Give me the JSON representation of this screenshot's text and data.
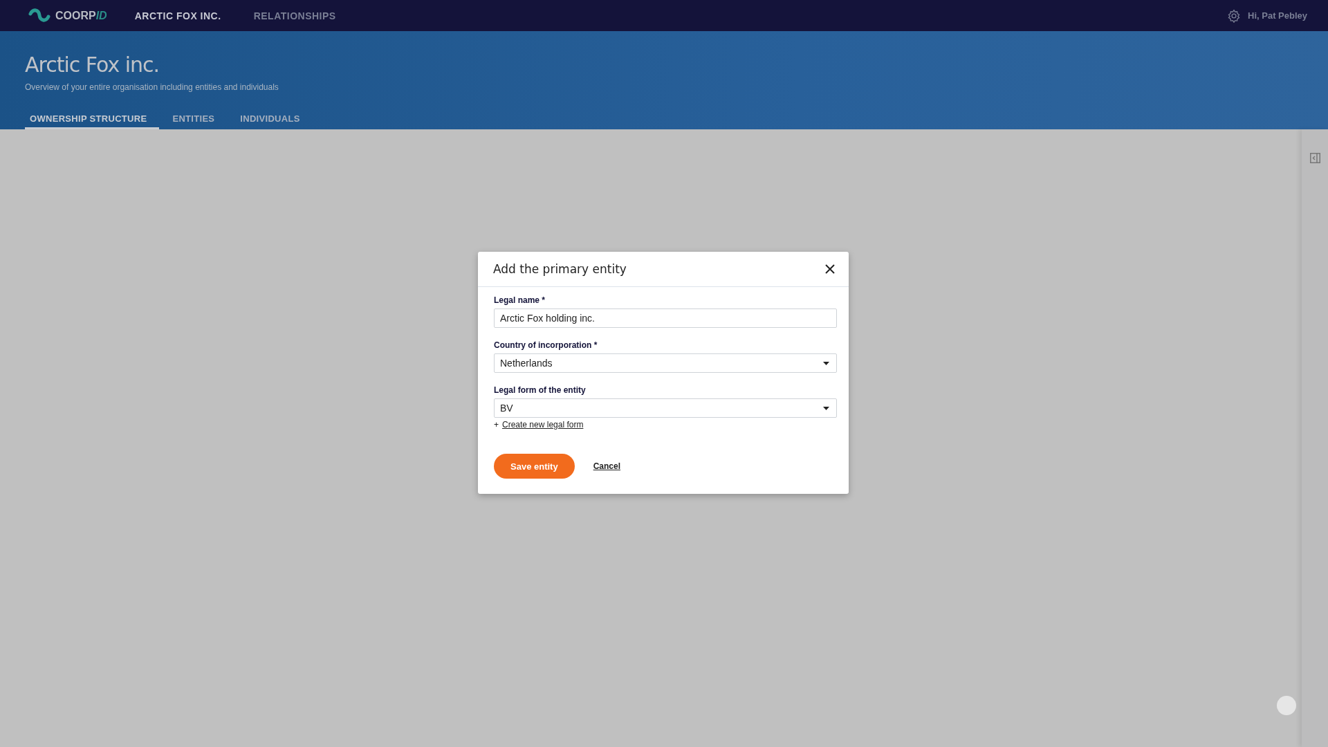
{
  "top_nav": {
    "logo": {
      "text": "COORP",
      "accent": "ID"
    },
    "items": [
      {
        "label": "ARCTIC FOX INC.",
        "selected": true
      },
      {
        "label": "RELATIONSHIPS",
        "selected": false
      }
    ],
    "greeting": "Hi, Pat Pebley"
  },
  "header": {
    "title": "Arctic Fox inc.",
    "subtitle": "Overview of your entire organisation including entities and individuals"
  },
  "tabs": [
    {
      "label": "OWNERSHIP STRUCTURE",
      "selected": true
    },
    {
      "label": "ENTITIES",
      "selected": false
    },
    {
      "label": "INDIVIDUALS",
      "selected": false
    }
  ],
  "dialog": {
    "title": "Add the primary entity",
    "fields": [
      {
        "kind": "text",
        "label": "Legal name *",
        "value": "Arctic Fox holding inc."
      },
      {
        "kind": "select",
        "label": "Country of incorporation *",
        "value": "Netherlands"
      },
      {
        "kind": "select",
        "label": "Legal form of the entity",
        "value": "BV"
      }
    ],
    "create_link": {
      "prefix": "+",
      "label": "Create new legal form"
    },
    "save_button": "Save entity",
    "cancel_link": "Cancel"
  }
}
